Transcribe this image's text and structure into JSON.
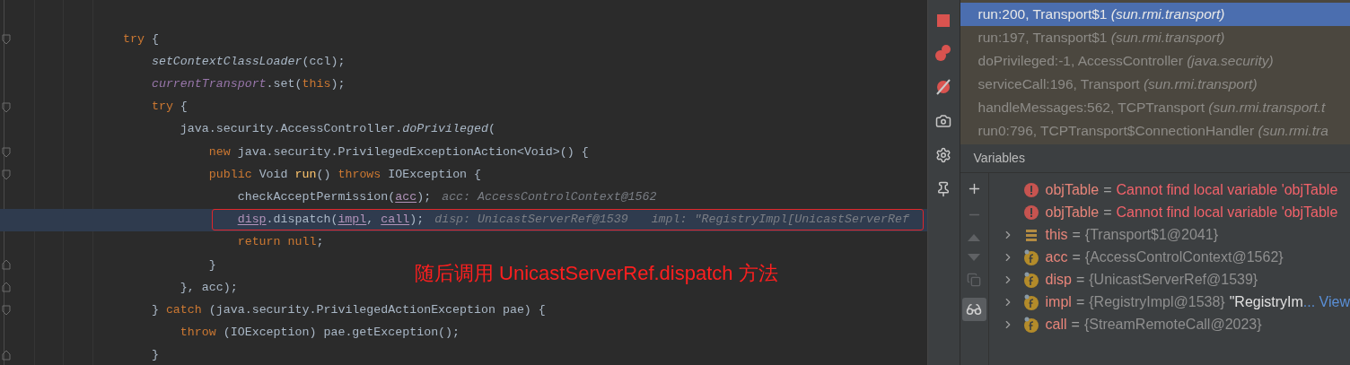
{
  "editor": {
    "lines": [
      {
        "fold_start": true,
        "fold_end": false,
        "current": false,
        "boxed": false,
        "tokens": [
          {
            "kind": "keyword",
            "text": "try"
          },
          {
            "kind": "plain",
            "text": " {"
          }
        ]
      },
      {
        "fold_start": false,
        "fold_end": false,
        "current": false,
        "boxed": false,
        "tokens": [
          {
            "kind": "call",
            "text": "    setContextClassLoader"
          },
          {
            "kind": "plain",
            "text": "(ccl);"
          }
        ]
      },
      {
        "fold_start": false,
        "fold_end": false,
        "current": false,
        "boxed": false,
        "tokens": [
          {
            "kind": "field",
            "text": "    currentTransport"
          },
          {
            "kind": "plain",
            "text": ".set("
          },
          {
            "kind": "keyword",
            "text": "this"
          },
          {
            "kind": "plain",
            "text": ");"
          }
        ]
      },
      {
        "fold_start": true,
        "fold_end": false,
        "current": false,
        "boxed": false,
        "tokens": [
          {
            "kind": "keyword",
            "text": "    try"
          },
          {
            "kind": "plain",
            "text": " {"
          }
        ]
      },
      {
        "fold_start": false,
        "fold_end": false,
        "current": false,
        "boxed": false,
        "tokens": [
          {
            "kind": "plain",
            "text": "        java.security.AccessController."
          },
          {
            "kind": "call",
            "text": "doPrivileged"
          },
          {
            "kind": "plain",
            "text": "("
          }
        ]
      },
      {
        "fold_start": true,
        "fold_end": false,
        "current": false,
        "boxed": false,
        "tokens": [
          {
            "kind": "keyword",
            "text": "            new"
          },
          {
            "kind": "plain",
            "text": " java.security.PrivilegedExceptionAction<Void>() {"
          }
        ]
      },
      {
        "fold_start": true,
        "fold_end": false,
        "current": false,
        "boxed": false,
        "tokens": [
          {
            "kind": "keyword",
            "text": "            public"
          },
          {
            "kind": "plain",
            "text": " Void "
          },
          {
            "kind": "method",
            "text": "run"
          },
          {
            "kind": "plain",
            "text": "() "
          },
          {
            "kind": "keyword",
            "text": "throws"
          },
          {
            "kind": "plain",
            "text": " IOException {"
          }
        ]
      },
      {
        "fold_start": false,
        "fold_end": false,
        "current": false,
        "boxed": false,
        "tokens": [
          {
            "kind": "plain",
            "text": "                checkAcceptPermission("
          },
          {
            "kind": "variable",
            "text": "acc"
          },
          {
            "kind": "plain",
            "text": ");"
          }
        ],
        "hints": [
          "acc: AccessControlContext@1562"
        ]
      },
      {
        "fold_start": false,
        "fold_end": false,
        "current": true,
        "boxed": true,
        "tokens": [
          {
            "kind": "variable",
            "text": "                disp"
          },
          {
            "kind": "plain",
            "text": ".dispatch("
          },
          {
            "kind": "variable",
            "text": "impl"
          },
          {
            "kind": "plain",
            "text": ", "
          },
          {
            "kind": "variable",
            "text": "call"
          },
          {
            "kind": "plain",
            "text": ");"
          }
        ],
        "hints": [
          "disp: UnicastServerRef@1539",
          "impl: \"RegistryImpl[UnicastServerRef"
        ]
      },
      {
        "fold_start": false,
        "fold_end": false,
        "current": false,
        "boxed": false,
        "tokens": [
          {
            "kind": "keyword",
            "text": "                return null"
          },
          {
            "kind": "plain",
            "text": ";"
          }
        ]
      },
      {
        "fold_start": false,
        "fold_end": true,
        "current": false,
        "boxed": false,
        "tokens": [
          {
            "kind": "plain",
            "text": "            }"
          }
        ]
      },
      {
        "fold_start": false,
        "fold_end": true,
        "current": false,
        "boxed": false,
        "tokens": [
          {
            "kind": "plain",
            "text": "        }, acc);"
          }
        ]
      },
      {
        "fold_start": true,
        "fold_end": false,
        "current": false,
        "boxed": false,
        "tokens": [
          {
            "kind": "plain",
            "text": "    } "
          },
          {
            "kind": "keyword",
            "text": "catch"
          },
          {
            "kind": "plain",
            "text": " (java.security.PrivilegedActionException pae) {"
          }
        ]
      },
      {
        "fold_start": false,
        "fold_end": false,
        "current": false,
        "boxed": false,
        "tokens": [
          {
            "kind": "keyword",
            "text": "        throw"
          },
          {
            "kind": "plain",
            "text": " (IOException) pae.getException();"
          }
        ]
      },
      {
        "fold_start": false,
        "fold_end": true,
        "current": false,
        "boxed": false,
        "tokens": [
          {
            "kind": "plain",
            "text": "    }"
          }
        ]
      }
    ],
    "annotation": "随后调用 UnicastServerRef.dispatch 方法"
  },
  "frames": [
    {
      "text": "run:200, Transport$1",
      "package": "(sun.rmi.transport)",
      "selected": true
    },
    {
      "text": "run:197, Transport$1",
      "package": "(sun.rmi.transport)",
      "selected": false
    },
    {
      "text": "doPrivileged:-1, AccessController",
      "package": "(java.security)",
      "selected": false
    },
    {
      "text": "serviceCall:196, Transport",
      "package": "(sun.rmi.transport)",
      "selected": false
    },
    {
      "text": "handleMessages:562, TCPTransport",
      "package": "(sun.rmi.transport.t",
      "selected": false
    },
    {
      "text": "run0:796, TCPTransport$ConnectionHandler",
      "package": "(sun.rmi.tra",
      "selected": false
    }
  ],
  "variables_title": "Variables",
  "variables": [
    {
      "kind": "error",
      "name": "objTable",
      "operator": "=",
      "value": "Cannot find local variable 'objTable"
    },
    {
      "kind": "error",
      "name": "objTable",
      "operator": "=",
      "value": "Cannot find local variable 'objTable"
    },
    {
      "kind": "object",
      "name": "this",
      "operator": "=",
      "value": "{Transport$1@2041}"
    },
    {
      "kind": "field",
      "name": "acc",
      "operator": "=",
      "value": "{AccessControlContext@1562}"
    },
    {
      "kind": "field",
      "name": "disp",
      "operator": "=",
      "value": "{UnicastServerRef@1539}"
    },
    {
      "kind": "field",
      "name": "impl",
      "operator": "=",
      "value": "{RegistryImpl@1538}",
      "string": "\"RegistryIm",
      "link": "... View"
    },
    {
      "kind": "field",
      "name": "call",
      "operator": "=",
      "value": "{StreamRemoteCall@2023}"
    }
  ]
}
